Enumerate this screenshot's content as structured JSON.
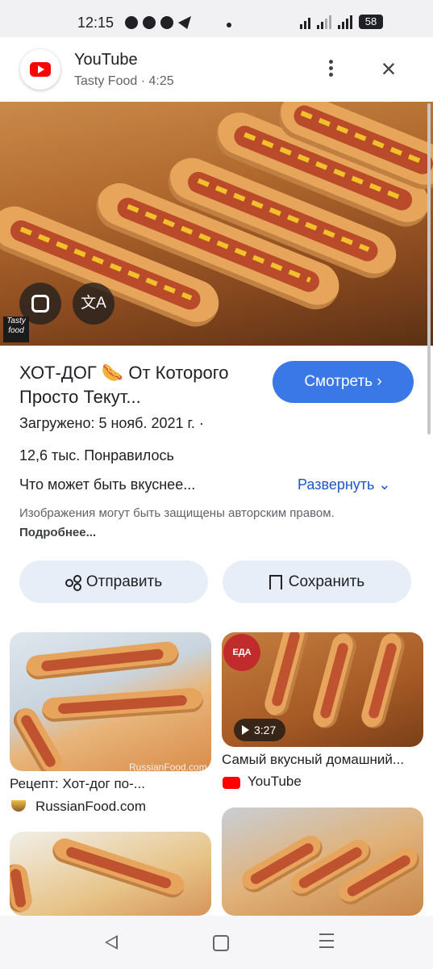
{
  "status_bar": {
    "time": "12:15",
    "battery": "58"
  },
  "header": {
    "app_name": "YouTube",
    "subtitle": "Tasty Food · 4:25"
  },
  "hero": {
    "translate_glyph": "文A",
    "brand_watermark": "Tasty food"
  },
  "info": {
    "title": "ХОТ-ДОГ 🌭 От Которого Просто Текут...",
    "watch_label": "Смотреть ›",
    "uploaded": "Загружено: 5 нояб. 2021 г.  ·",
    "likes": "12,6 тыс. Понравилось",
    "description": "Что может быть вкуснее...",
    "expand_label": "Развернуть ⌄",
    "copyright_text": "Изображения могут быть защищены авторским правом.",
    "copyright_more": "Подробнее..."
  },
  "actions": {
    "share_label": "Отправить",
    "save_label": "Сохранить"
  },
  "related": [
    {
      "caption": "Рецепт: Хот-дог по-...",
      "source": "RussianFood.com",
      "watermark": "RussianFood.com"
    },
    {
      "caption": "Самый вкусный домашний...",
      "source": "YouTube",
      "duration": "3:27",
      "badge": "ЕДА"
    },
    {
      "caption": "",
      "source": ""
    },
    {
      "caption": "",
      "source": ""
    }
  ],
  "colors": {
    "accent": "#3b78e7",
    "link": "#1a57c6",
    "youtube_red": "#ff0000"
  }
}
